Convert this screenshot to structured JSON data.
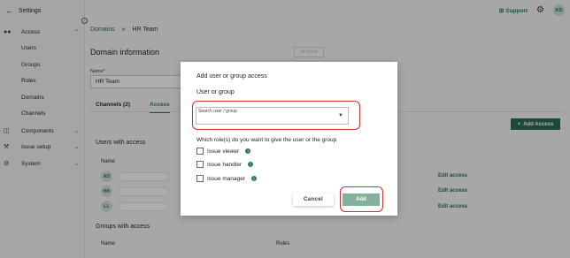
{
  "sidebar": {
    "header": {
      "back_icon": "arrow-left-icon",
      "label": "Settings"
    },
    "access": {
      "icon": "people-icon",
      "label": "Access",
      "chevron": "chevron-up-icon"
    },
    "sub_items": [
      "Users",
      "Groups",
      "Roles",
      "Domains",
      "Channels"
    ],
    "components": {
      "icon": "database-icon",
      "label": "Components",
      "chevron": "chevron-down-icon"
    },
    "issue_setup": {
      "icon": "wrench-icon",
      "label": "Issue setup",
      "chevron": "chevron-down-icon"
    },
    "system": {
      "icon": "gear-icon",
      "label": "System",
      "chevron": "chevron-down-icon"
    }
  },
  "topbar": {
    "support_label": "Support",
    "support_icon": "plus-square-icon",
    "settings_icon": "gear-icon",
    "avatar_initials": "KD"
  },
  "breadcrumb": {
    "items": [
      "Domains",
      "HR Team"
    ],
    "separator": "»"
  },
  "page": {
    "title": "Domain information",
    "archive_label": "Archive",
    "name_label": "Name*",
    "name_value": "HR Team",
    "tabs": [
      "Channels (2)",
      "Access"
    ],
    "add_access_label": "Add Access",
    "users_title": "Users with access",
    "name_column": "Name",
    "users": [
      {
        "initials": "AD",
        "action": "Edit access"
      },
      {
        "initials": "HK",
        "action": "Edit access"
      },
      {
        "initials": "LL",
        "action": "Edit access"
      }
    ],
    "groups_title": "Groups with access",
    "groups_columns": [
      "Name",
      "Roles"
    ]
  },
  "modal": {
    "title": "Add user or group access",
    "subtitle": "User or group",
    "search_label": "Search user / group",
    "search_value": "",
    "question": "Which role(s) do you want to give the user or the group",
    "roles": [
      {
        "label": "Issue viewer",
        "checked": false
      },
      {
        "label": "Issue handler",
        "checked": false
      },
      {
        "label": "Issue manager",
        "checked": false
      }
    ],
    "cancel_label": "Cancel",
    "add_label": "Add"
  },
  "colors": {
    "primary": "#2f6e52",
    "accent": "#2f7a5b",
    "disabled_primary": "#83b29c",
    "highlight": "#e02b2b"
  }
}
